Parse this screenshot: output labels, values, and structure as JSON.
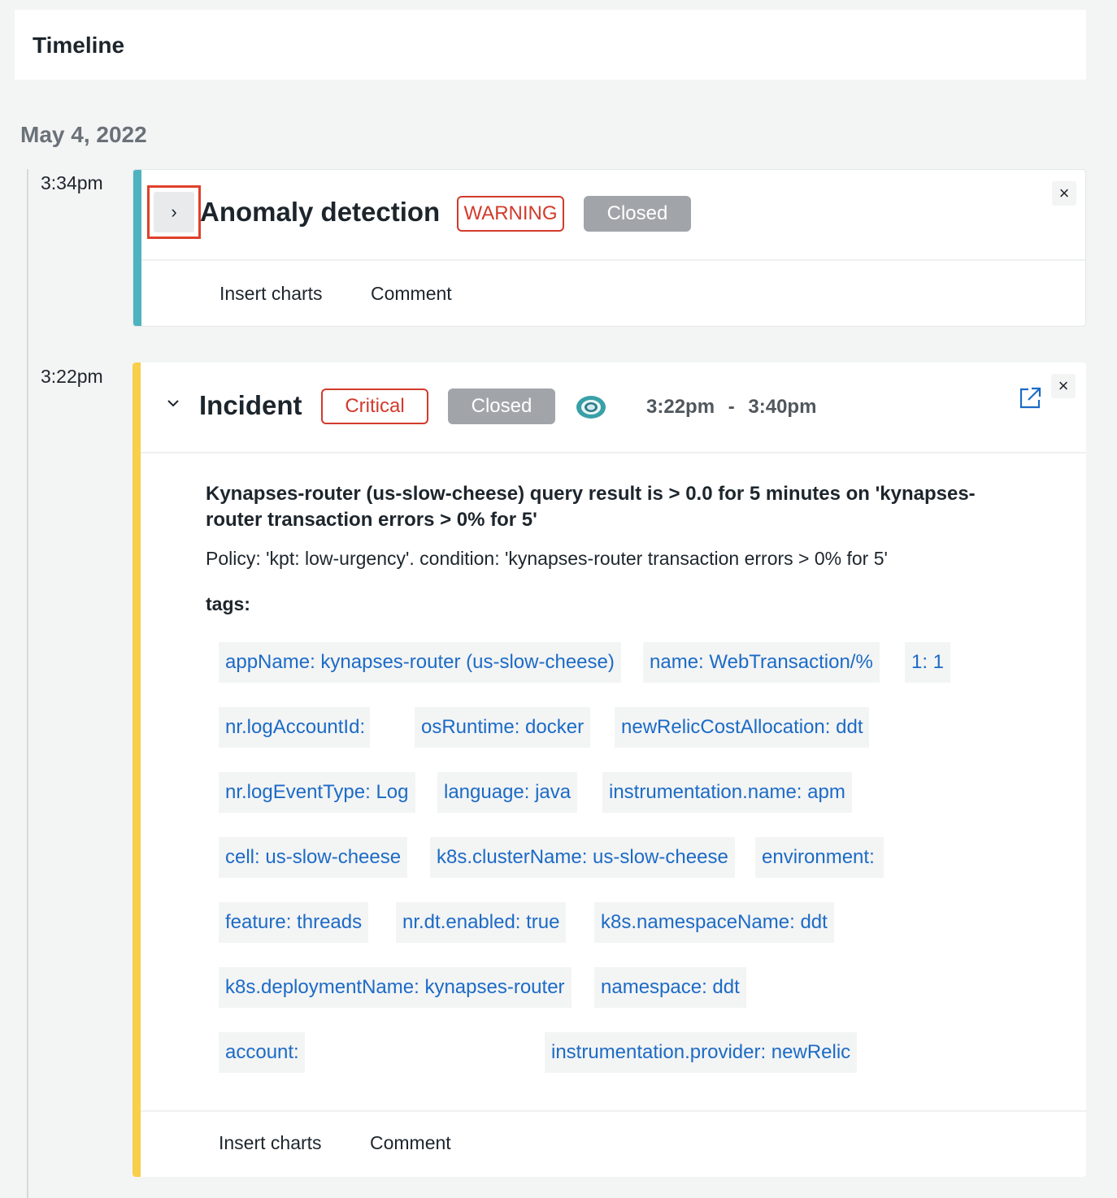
{
  "header": {
    "title": "Timeline"
  },
  "date": "May 4, 2022",
  "events": [
    {
      "time": "3:34pm",
      "title": "Anomaly detection",
      "severity": "WARNING",
      "status": "Closed",
      "actions": {
        "insert_charts": "Insert charts",
        "comment": "Comment"
      },
      "accent_color": "#4fb3bf",
      "expanded": false
    },
    {
      "time": "3:22pm",
      "title": "Incident",
      "severity": "Critical",
      "status": "Closed",
      "time_range": {
        "start": "3:22pm",
        "separator": "-",
        "end": "3:40pm"
      },
      "summary": "Kynapses-router (us-slow-cheese) query result is > 0.0 for 5 minutes on 'kynapses-router transaction errors > 0% for 5'",
      "policy": "Policy: 'kpt: low-urgency'. condition: 'kynapses-router transaction errors > 0% for 5'",
      "tags_heading": "tags:",
      "tags": [
        "appName: kynapses-router (us-slow-cheese)",
        "name: WebTransaction/%",
        "1: 1",
        "nr.logAccountId:",
        "osRuntime: docker",
        "newRelicCostAllocation: ddt",
        "nr.logEventType: Log",
        "language: java",
        "instrumentation.name: apm",
        "cell: us-slow-cheese",
        "k8s.clusterName: us-slow-cheese",
        "environment:",
        "feature: threads",
        "nr.dt.enabled: true",
        "k8s.namespaceName: ddt",
        "k8s.deploymentName: kynapses-router",
        "namespace: ddt",
        "account:",
        "instrumentation.provider: newRelic"
      ],
      "actions": {
        "insert_charts": "Insert charts",
        "comment": "Comment"
      },
      "accent_color": "#f7cf4a",
      "expanded": true
    }
  ],
  "icons": {
    "expand": "chevron-right-icon",
    "collapse": "chevron-down-icon",
    "close": "close-icon",
    "open_external": "external-link-icon",
    "status": "ring-status-icon"
  },
  "colors": {
    "tag_text": "#1c6bc6",
    "severity_border": "#d13b2c",
    "closed_badge": "#a1a5a9",
    "highlight": "#e0402a"
  }
}
